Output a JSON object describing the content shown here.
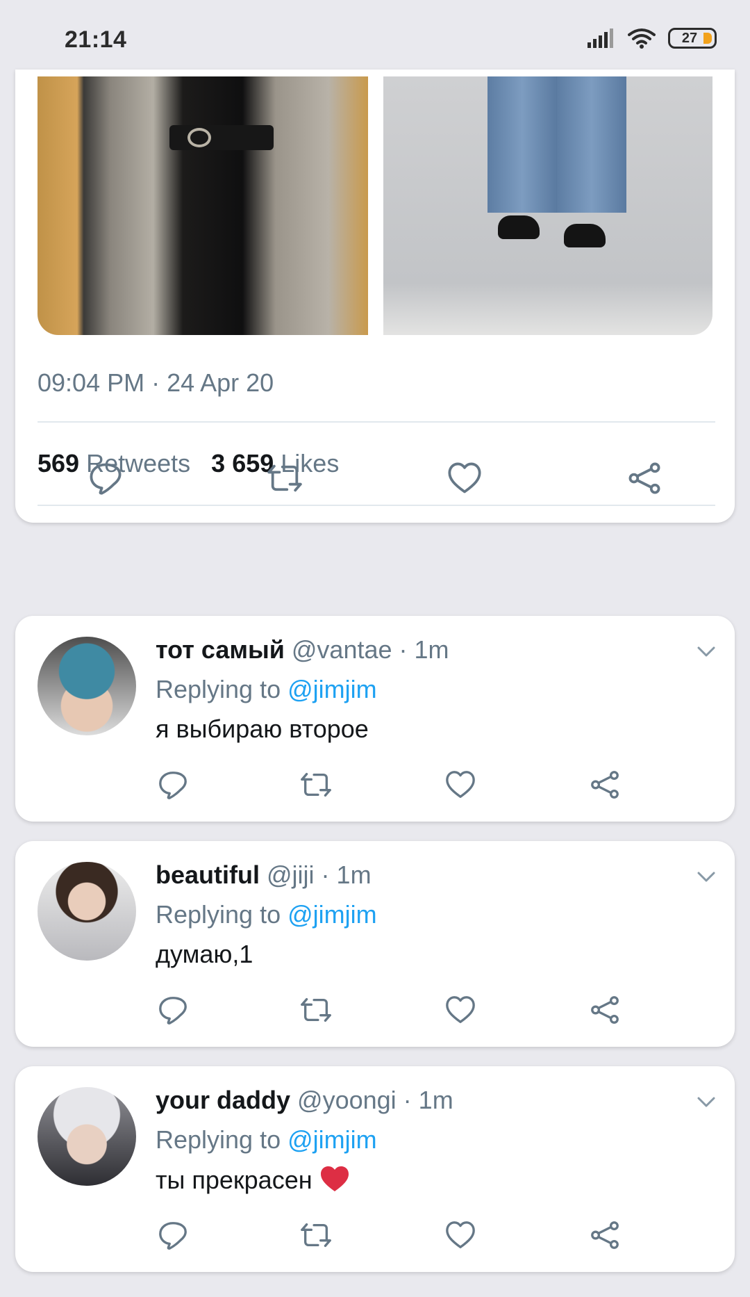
{
  "status_bar": {
    "time": "21:14",
    "battery": "27"
  },
  "main_tweet": {
    "timestamp": "09:04 PM · 24 Apr 20",
    "retweets_count": "569",
    "retweets_label": "Retweets",
    "likes_count": "3 659",
    "likes_label": "Likes"
  },
  "replies": [
    {
      "name": "тот самый",
      "meta": "@vantae · 1m",
      "replying_prefix": "Replying to",
      "replying_handle": "@jimjim",
      "text": "я выбираю второе"
    },
    {
      "name": "beautiful",
      "meta": "@jiji · 1m",
      "replying_prefix": "Replying to",
      "replying_handle": "@jimjim",
      "text": "думаю,1"
    },
    {
      "name": "your daddy",
      "meta": "@yoongi · 1m",
      "replying_prefix": "Replying to",
      "replying_handle": "@jimjim",
      "text": "ты прекрасен"
    }
  ],
  "colors": {
    "accent": "#1da1f2",
    "secondary_text": "#657786",
    "icon": "#657786",
    "emoji_heart": "#dd2e44"
  },
  "icons": [
    "reply-icon",
    "retweet-icon",
    "like-icon",
    "share-icon",
    "chevron-down-icon",
    "signal-icon",
    "wifi-icon",
    "battery-icon"
  ]
}
